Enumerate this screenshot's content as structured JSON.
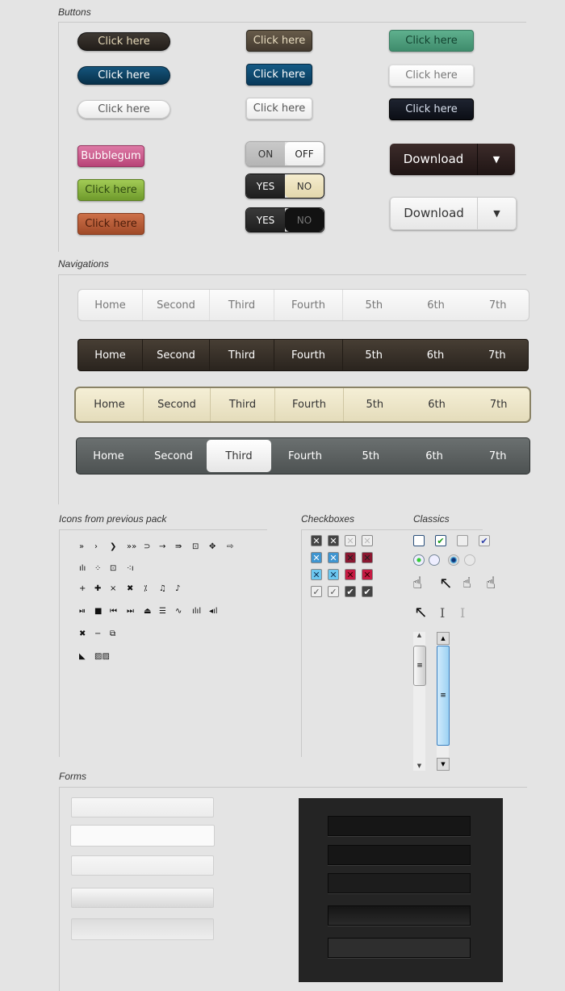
{
  "sections": {
    "buttons": "Buttons",
    "navigations": "Navigations",
    "icons": "Icons from previous pack",
    "checkboxes": "Checkboxes",
    "classics": "Classics",
    "forms": "Forms"
  },
  "buttons": {
    "click": "Click here",
    "bubblegum": "Bubblegum",
    "download": "Download"
  },
  "toggles": [
    {
      "left": "ON",
      "right": "OFF"
    },
    {
      "left": "YES",
      "right": "NO"
    },
    {
      "left": "YES",
      "right": "NO"
    }
  ],
  "nav_items": [
    "Home",
    "Second",
    "Third",
    "Fourth",
    "5th",
    "6th",
    "7th"
  ],
  "nav_active": "Third",
  "colors": {
    "dark_brown": "#2f2924",
    "navy": "#0b3d5c",
    "teal": "#4a9c7c",
    "pink": "#c8578a",
    "green": "#82ae3c",
    "rust": "#b25a35",
    "dark_panel": "#232323"
  },
  "icons": [
    [
      "»",
      "›",
      "❯",
      "»»",
      "⊃",
      "→",
      "⇛",
      "⊡",
      "✥",
      "⇨"
    ],
    [
      "ılı",
      "⁘",
      "⊡",
      "⁖ı"
    ],
    [
      "+",
      "✚",
      "×",
      "✖",
      "⁒",
      "♫",
      "♪"
    ],
    [
      "⏯",
      "■",
      "⏮",
      "⏭",
      "⏏",
      "☰",
      "∿",
      "ılıl",
      "◂ıl"
    ],
    [
      "✖",
      "−",
      "⧉"
    ],
    [
      "◣",
      "▨▨"
    ]
  ],
  "classics": {
    "cursors": [
      "☝",
      "↖",
      "☝",
      "☝"
    ],
    "cursors2": [
      "↖",
      "I",
      "I"
    ],
    "scroll_grip": "≡",
    "scroll_up": "▲",
    "scroll_down": "▼"
  }
}
